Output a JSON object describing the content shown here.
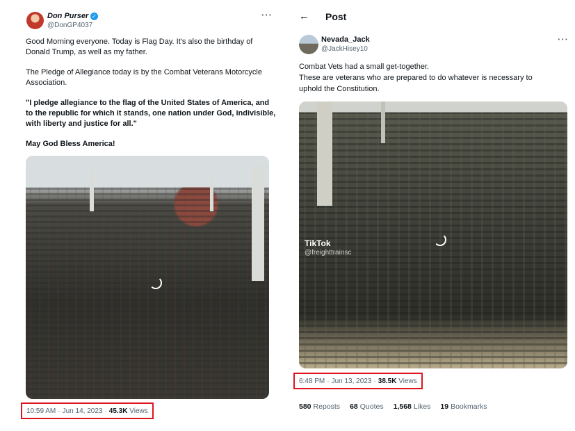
{
  "left_tweet": {
    "author_name": "Don Purser",
    "author_handle": "@DonGP4037",
    "lines": [
      "Good Morning everyone. Today is Flag Day. It's also the birthday of",
      "Donald Trump, as well as my father.",
      "The Pledge of Allegiance today is by the Combat Veterans Motorcycle",
      "Association."
    ],
    "pledge_lines": [
      "\"I pledge allegiance to the flag of the United States of America, and",
      "to the republic for which it stands, one nation under God, indivisible,",
      "with liberty and justice for all.\""
    ],
    "closing": "May God Bless America!",
    "time": "10:59 AM",
    "date": "Jun 14, 2023",
    "views_count": "45.3K",
    "views_label": "Views"
  },
  "right_tweet": {
    "header_title": "Post",
    "author_name": "Nevada_Jack",
    "author_handle": "@JackHisey10",
    "lines": [
      "Combat Vets had a small get-together.",
      "These are veterans who are prepared to do whatever is necessary to",
      "uphold the Constitution."
    ],
    "watermark_logo": "TikTok",
    "watermark_handle": "@freighttrainsc",
    "time": "6:48 PM",
    "date": "Jun 13, 2023",
    "views_count": "38.5K",
    "views_label": "Views",
    "stats": {
      "reposts_count": "580",
      "reposts_label": "Reposts",
      "quotes_count": "68",
      "quotes_label": "Quotes",
      "likes_count": "1,568",
      "likes_label": "Likes",
      "bookmarks_count": "19",
      "bookmarks_label": "Bookmarks"
    }
  },
  "icons": {
    "verified": "verified-badge-icon",
    "more": "more-options-icon",
    "back": "back-arrow-icon"
  },
  "colors": {
    "highlight_box": "#e0141e",
    "verified": "#1d9bf0",
    "secondary_text": "#536471"
  }
}
